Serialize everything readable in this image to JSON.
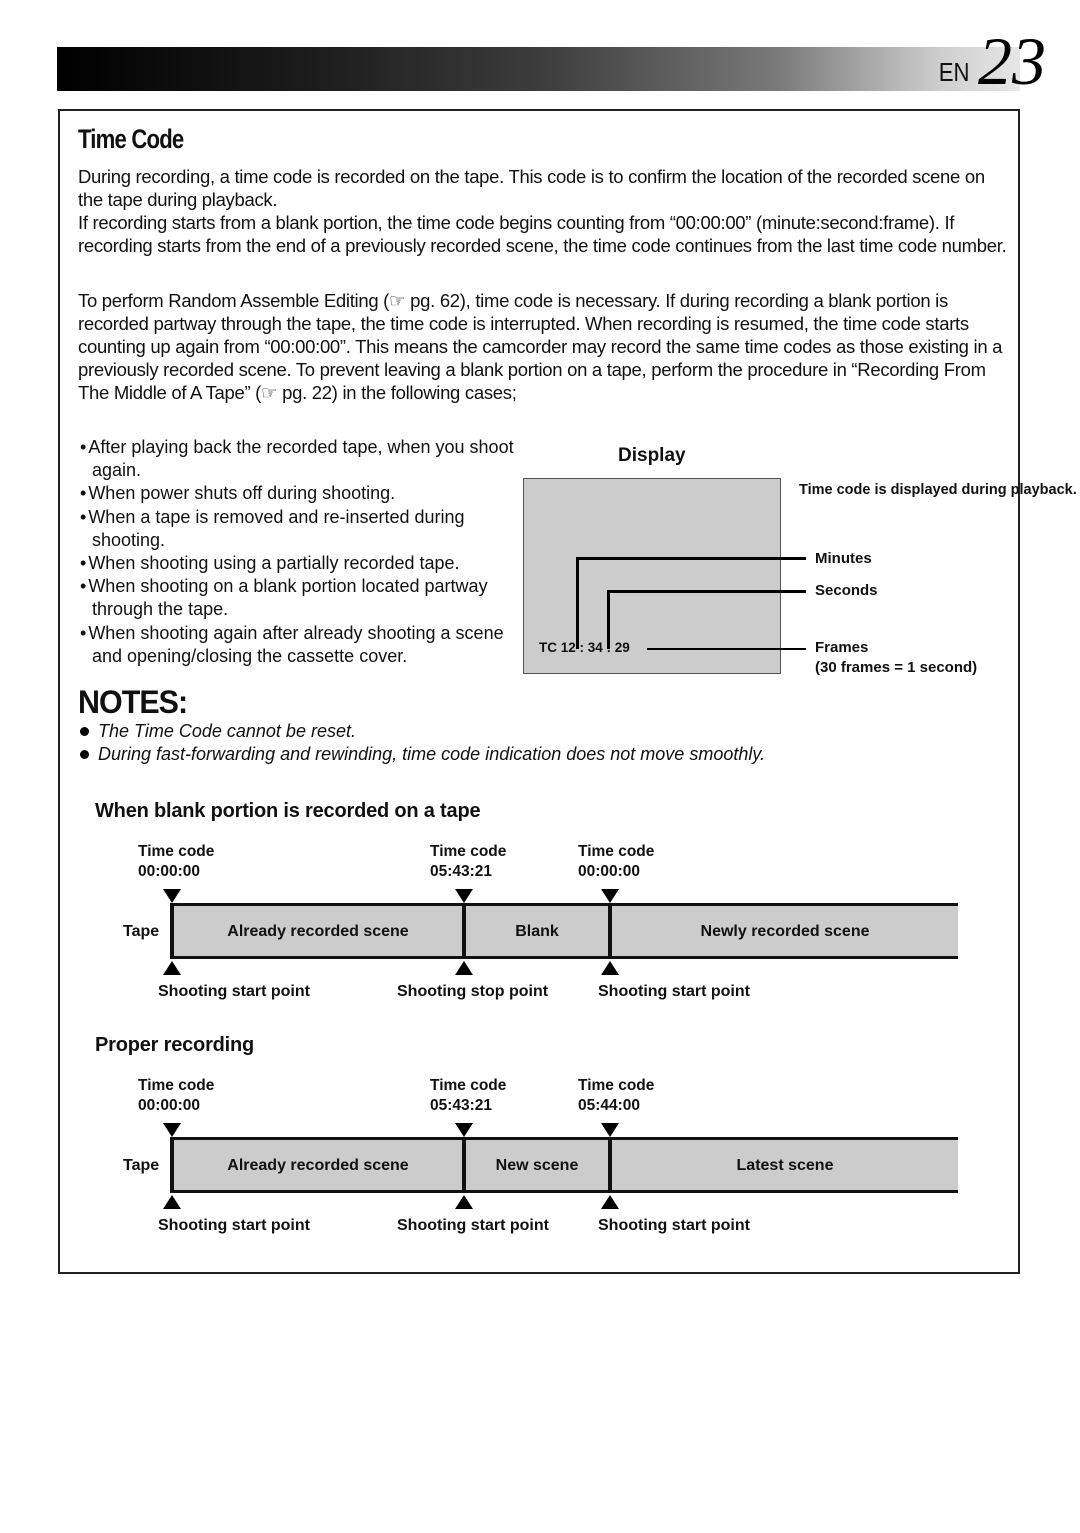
{
  "header": {
    "lang": "EN",
    "page_number": "23"
  },
  "section": {
    "title": "Time Code",
    "intro_lines": [
      "During recording, a time code is recorded on the tape. This code is to confirm the location of the recorded scene on the tape during playback.",
      "If recording starts from a blank portion, the time code begins counting from “00:00:00” (minute:second:frame). If recording starts from the end of a previously recorded scene, the time code continues from the last time code number."
    ],
    "para2": "To perform Random Assemble Editing (☞ pg. 62), time code is necessary. If during recording a blank portion is recorded partway through the tape, the time code is interrupted. When recording is resumed, the time code starts counting up again from “00:00:00”. This means the camcorder may record the same time codes as those existing in a previously recorded scene. To prevent leaving a blank portion on a tape, perform the procedure in “Recording From The Middle of A Tape” (☞ pg. 22) in the following cases;",
    "cases": [
      "After playing back the recorded tape, when you shoot again.",
      "When power shuts off during shooting.",
      "When a tape is removed and re-inserted during shooting.",
      "When shooting using a partially recorded tape.",
      "When shooting on a blank portion located partway through the tape.",
      "When shooting again after already shooting a scene and opening/closing the cassette cover."
    ]
  },
  "display": {
    "label": "Display",
    "tc_readout": "TC  12 : 34 : 29",
    "caption": "Time code is displayed during playback.",
    "minutes": "Minutes",
    "seconds": "Seconds",
    "frames": "Frames",
    "frames_note": "(30 frames = 1 second)"
  },
  "notes": {
    "title": "NOTES:",
    "items": [
      "The Time Code cannot be reset.",
      "During fast-forwarding and rewinding, time code indication does not move smoothly."
    ]
  },
  "diagrams": [
    {
      "title": "When blank portion is recorded on a tape",
      "tape_label": "Tape",
      "markers": [
        {
          "tc_label": "Time code",
          "tc_value": "00:00:00",
          "point": "Shooting start point"
        },
        {
          "tc_label": "Time code",
          "tc_value": "05:43:21",
          "point": "Shooting stop point"
        },
        {
          "tc_label": "Time code",
          "tc_value": "00:00:00",
          "point": "Shooting start point"
        }
      ],
      "segments": [
        "Already recorded scene",
        "Blank",
        "Newly recorded scene"
      ]
    },
    {
      "title": "Proper recording",
      "tape_label": "Tape",
      "markers": [
        {
          "tc_label": "Time code",
          "tc_value": "00:00:00",
          "point": "Shooting start point"
        },
        {
          "tc_label": "Time code",
          "tc_value": "05:43:21",
          "point": "Shooting start point"
        },
        {
          "tc_label": "Time code",
          "tc_value": "05:44:00",
          "point": "Shooting start point"
        }
      ],
      "segments": [
        "Already recorded scene",
        "New scene",
        "Latest scene"
      ]
    }
  ]
}
